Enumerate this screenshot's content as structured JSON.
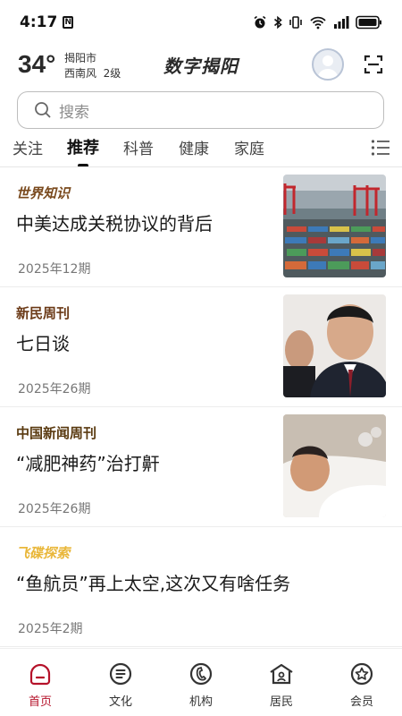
{
  "status_bar": {
    "time": "4:17"
  },
  "header": {
    "temperature": "34°",
    "city": "揭阳市",
    "wind": "西南风  2级",
    "app_title": "数字揭阳"
  },
  "search": {
    "placeholder": "搜索"
  },
  "tabs": [
    {
      "label": "关注",
      "active": false
    },
    {
      "label": "推荐",
      "active": true
    },
    {
      "label": "科普",
      "active": false
    },
    {
      "label": "健康",
      "active": false
    },
    {
      "label": "家庭",
      "active": false
    }
  ],
  "articles": [
    {
      "source": "世界知识",
      "source_color": "#7a4a1e",
      "title": "中美达成关税协议的背后",
      "issue": "2025年12期"
    },
    {
      "source": "新民周刊",
      "source_color": "#6b3a17",
      "title": "七日谈",
      "issue": "2025年26期"
    },
    {
      "source": "中国新闻周刊",
      "source_color": "#5a3a10",
      "title": "“减肥神药”治打鼾",
      "issue": "2025年26期"
    },
    {
      "source": "飞碟探索",
      "source_color": "#e9b73a",
      "title": "“鱼航员”再上太空,这次又有啥任务",
      "issue": "2025年2期"
    }
  ],
  "bottom_nav": [
    {
      "label": "首页",
      "icon": "home-icon",
      "active": true
    },
    {
      "label": "文化",
      "icon": "culture-icon",
      "active": false
    },
    {
      "label": "机构",
      "icon": "institution-icon",
      "active": false
    },
    {
      "label": "居民",
      "icon": "residents-icon",
      "active": false
    },
    {
      "label": "会员",
      "icon": "member-icon",
      "active": false
    }
  ],
  "colors": {
    "accent": "#b5122a",
    "text": "#1a1a1a",
    "muted": "#777777"
  }
}
